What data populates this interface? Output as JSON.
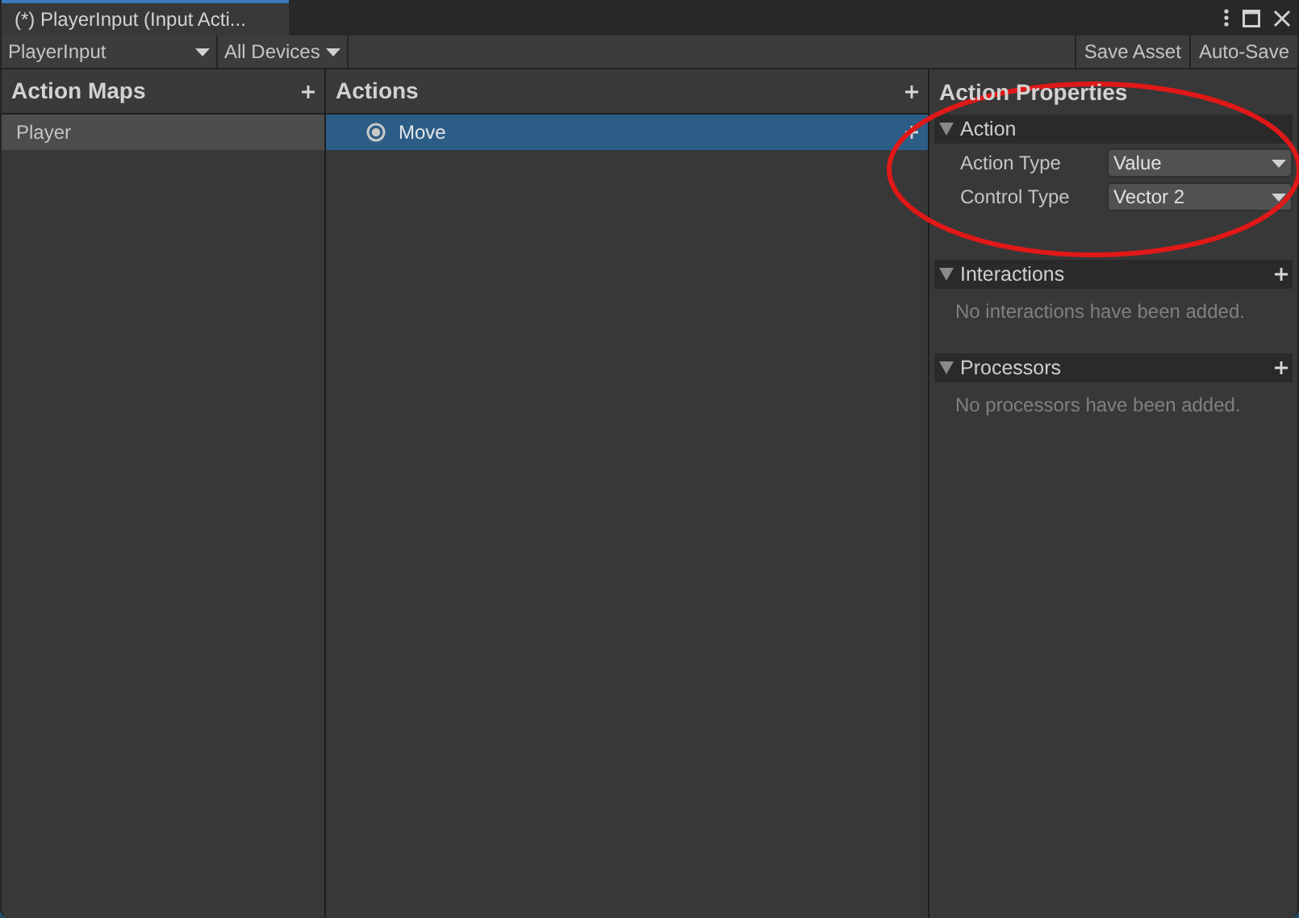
{
  "window": {
    "title": "(*) PlayerInput (Input Acti..."
  },
  "toolbar": {
    "asset_dropdown": "PlayerInput",
    "device_dropdown": "All Devices",
    "buttons": [
      "Save Asset",
      "Auto-Save"
    ]
  },
  "action_maps": {
    "title": "Action Maps",
    "focused": false,
    "items": [
      {
        "label": "Player",
        "selected": true
      }
    ]
  },
  "actions": {
    "title": "Actions",
    "focused": true,
    "items": [
      {
        "label": "Move",
        "selected": true
      }
    ]
  },
  "properties": {
    "title": "Action Properties",
    "sections": [
      {
        "kind": "fields",
        "title": "Action",
        "fields": [
          {
            "label": "Action Type",
            "value": "Value"
          },
          {
            "label": "Control Type",
            "value": "Vector 2"
          }
        ]
      },
      {
        "kind": "list",
        "title": "Interactions",
        "message": "No interactions have been added."
      },
      {
        "kind": "list",
        "title": "Processors",
        "message": "No processors have been added."
      }
    ]
  }
}
